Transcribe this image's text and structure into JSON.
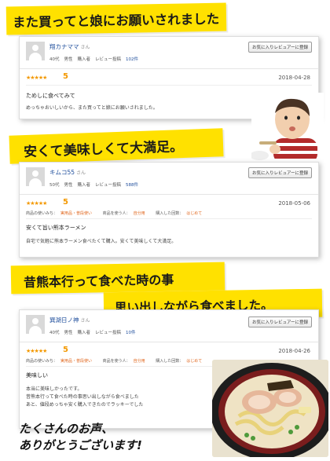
{
  "banners": {
    "b1": "また買ってと娘にお願いされました",
    "b2": "安くて美味しくて大満足。",
    "b3a": "昔熊本行って食べた時の事",
    "b3b": "思い出しながら食べました。"
  },
  "reviews": [
    {
      "user": "翔カナママ",
      "san": "さん",
      "age": "40代",
      "gender": "男性",
      "buyer": "購入者",
      "posts_label": "レビュー投稿",
      "posts": "102件",
      "fav": "お気に入りレビュアーに登録",
      "stars": "★★★★★",
      "score": "5",
      "date": "2018-04-28",
      "title": "ためしに食べてみて",
      "body": "めっちゃおいしいから、また買ってと娘にお願いされました。"
    },
    {
      "user": "キムコ55",
      "san": "さん",
      "age": "50代",
      "gender": "男性",
      "buyer": "購入者",
      "posts_label": "レビュー投稿",
      "posts": "588件",
      "fav": "お気に入りレビュアーに登録",
      "stars": "★★★★★",
      "score": "5",
      "date": "2018-05-06",
      "usage_label": "商品の使いみち：",
      "usage": "実用品・普段使い",
      "user_label": "商品を使う人：",
      "user_val": "自分用",
      "times_label": "購入した回数：",
      "times": "はじめて",
      "title": "安くて旨い熊本ラーメン",
      "body": "自宅で気軽に熊本ラーメン食べたくて購入。安くて美味しくて大満足。"
    },
    {
      "user": "巽湖日ノ神",
      "san": "さん",
      "age": "40代",
      "gender": "男性",
      "buyer": "購入者",
      "posts_label": "レビュー投稿",
      "posts": "10件",
      "fav": "お気に入りレビュアーに登録",
      "stars": "★★★★★",
      "score": "5",
      "date": "2018-04-26",
      "usage_label": "商品の使いみち：",
      "usage": "実用品・普段使い",
      "user_label": "商品を使う人：",
      "user_val": "自分用",
      "times_label": "購入した回数：",
      "times": "はじめて",
      "title": "美味しい",
      "body1": "本当に美味しかったです。",
      "body2": "昔熊本行って食べた時の事思い出しながら食べました",
      "body3": "あと、値段めっちゃ安く購入できたのでラッキーでした"
    }
  ],
  "thanks1": "たくさんのお声、",
  "thanks2": "ありがとうございます!",
  "colors": {
    "banner": "#ffe100",
    "star": "#f39800",
    "link": "#1f4e9c",
    "tag": "#e0651b"
  }
}
